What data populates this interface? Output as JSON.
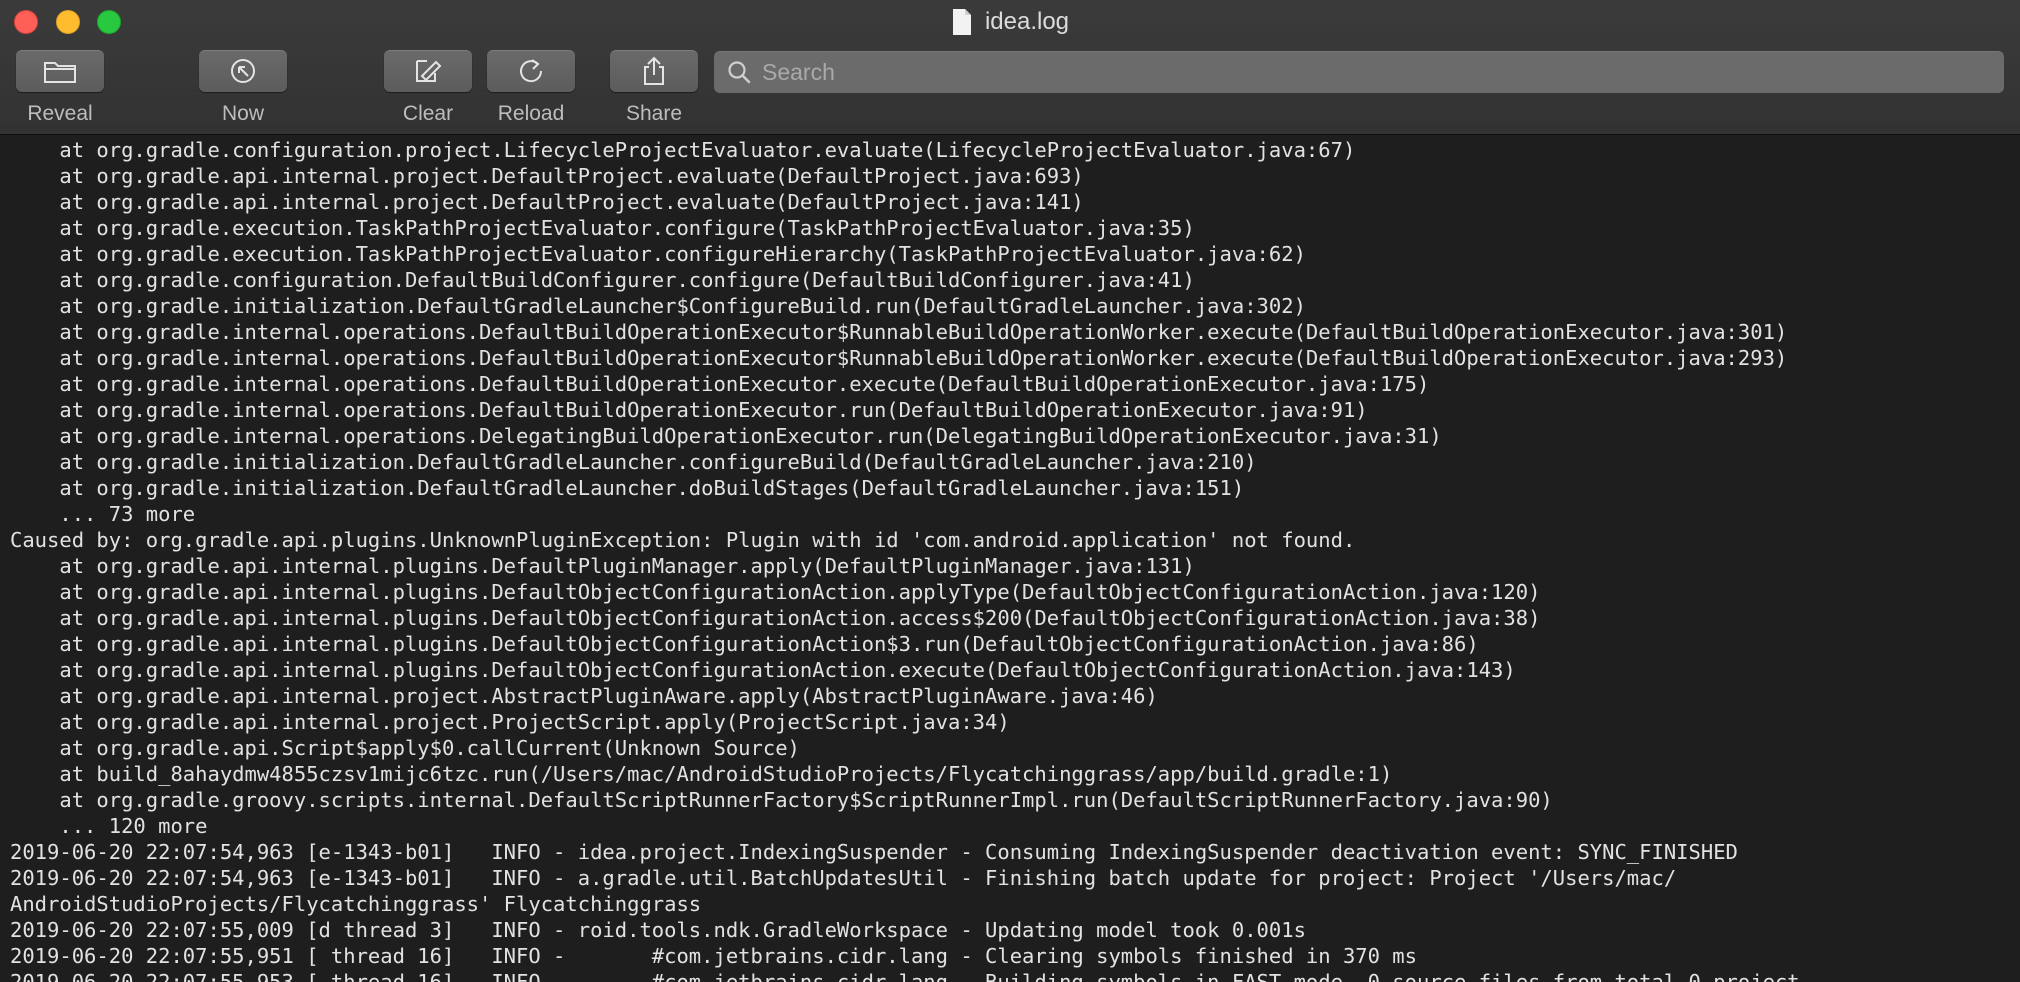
{
  "window": {
    "title": "idea.log"
  },
  "toolbar": {
    "reveal_label": "Reveal",
    "now_label": "Now",
    "clear_label": "Clear",
    "reload_label": "Reload",
    "share_label": "Share"
  },
  "search": {
    "placeholder": "Search",
    "value": ""
  },
  "log": {
    "lines": [
      "    at org.gradle.configuration.project.LifecycleProjectEvaluator.evaluate(LifecycleProjectEvaluator.java:67)",
      "    at org.gradle.api.internal.project.DefaultProject.evaluate(DefaultProject.java:693)",
      "    at org.gradle.api.internal.project.DefaultProject.evaluate(DefaultProject.java:141)",
      "    at org.gradle.execution.TaskPathProjectEvaluator.configure(TaskPathProjectEvaluator.java:35)",
      "    at org.gradle.execution.TaskPathProjectEvaluator.configureHierarchy(TaskPathProjectEvaluator.java:62)",
      "    at org.gradle.configuration.DefaultBuildConfigurer.configure(DefaultBuildConfigurer.java:41)",
      "    at org.gradle.initialization.DefaultGradleLauncher$ConfigureBuild.run(DefaultGradleLauncher.java:302)",
      "    at org.gradle.internal.operations.DefaultBuildOperationExecutor$RunnableBuildOperationWorker.execute(DefaultBuildOperationExecutor.java:301)",
      "    at org.gradle.internal.operations.DefaultBuildOperationExecutor$RunnableBuildOperationWorker.execute(DefaultBuildOperationExecutor.java:293)",
      "    at org.gradle.internal.operations.DefaultBuildOperationExecutor.execute(DefaultBuildOperationExecutor.java:175)",
      "    at org.gradle.internal.operations.DefaultBuildOperationExecutor.run(DefaultBuildOperationExecutor.java:91)",
      "    at org.gradle.internal.operations.DelegatingBuildOperationExecutor.run(DelegatingBuildOperationExecutor.java:31)",
      "    at org.gradle.initialization.DefaultGradleLauncher.configureBuild(DefaultGradleLauncher.java:210)",
      "    at org.gradle.initialization.DefaultGradleLauncher.doBuildStages(DefaultGradleLauncher.java:151)",
      "    ... 73 more",
      "Caused by: org.gradle.api.plugins.UnknownPluginException: Plugin with id 'com.android.application' not found.",
      "    at org.gradle.api.internal.plugins.DefaultPluginManager.apply(DefaultPluginManager.java:131)",
      "    at org.gradle.api.internal.plugins.DefaultObjectConfigurationAction.applyType(DefaultObjectConfigurationAction.java:120)",
      "    at org.gradle.api.internal.plugins.DefaultObjectConfigurationAction.access$200(DefaultObjectConfigurationAction.java:38)",
      "    at org.gradle.api.internal.plugins.DefaultObjectConfigurationAction$3.run(DefaultObjectConfigurationAction.java:86)",
      "    at org.gradle.api.internal.plugins.DefaultObjectConfigurationAction.execute(DefaultObjectConfigurationAction.java:143)",
      "    at org.gradle.api.internal.project.AbstractPluginAware.apply(AbstractPluginAware.java:46)",
      "    at org.gradle.api.internal.project.ProjectScript.apply(ProjectScript.java:34)",
      "    at org.gradle.api.Script$apply$0.callCurrent(Unknown Source)",
      "    at build_8ahaydmw4855czsv1mijc6tzc.run(/Users/mac/AndroidStudioProjects/Flycatchinggrass/app/build.gradle:1)",
      "    at org.gradle.groovy.scripts.internal.DefaultScriptRunnerFactory$ScriptRunnerImpl.run(DefaultScriptRunnerFactory.java:90)",
      "    ... 120 more",
      "2019-06-20 22:07:54,963 [e-1343-b01]   INFO - idea.project.IndexingSuspender - Consuming IndexingSuspender deactivation event: SYNC_FINISHED",
      "2019-06-20 22:07:54,963 [e-1343-b01]   INFO - a.gradle.util.BatchUpdatesUtil - Finishing batch update for project: Project '/Users/mac/",
      "AndroidStudioProjects/Flycatchinggrass' Flycatchinggrass",
      "2019-06-20 22:07:55,009 [d thread 3]   INFO - roid.tools.ndk.GradleWorkspace - Updating model took 0.001s",
      "2019-06-20 22:07:55,951 [ thread 16]   INFO -       #com.jetbrains.cidr.lang - Clearing symbols finished in 370 ms",
      "2019-06-20 22:07:55,953 [ thread 16]   INFO -       #com.jetbrains.cidr.lang - Building symbols in FAST mode, 0 source files from total 0 project"
    ]
  }
}
